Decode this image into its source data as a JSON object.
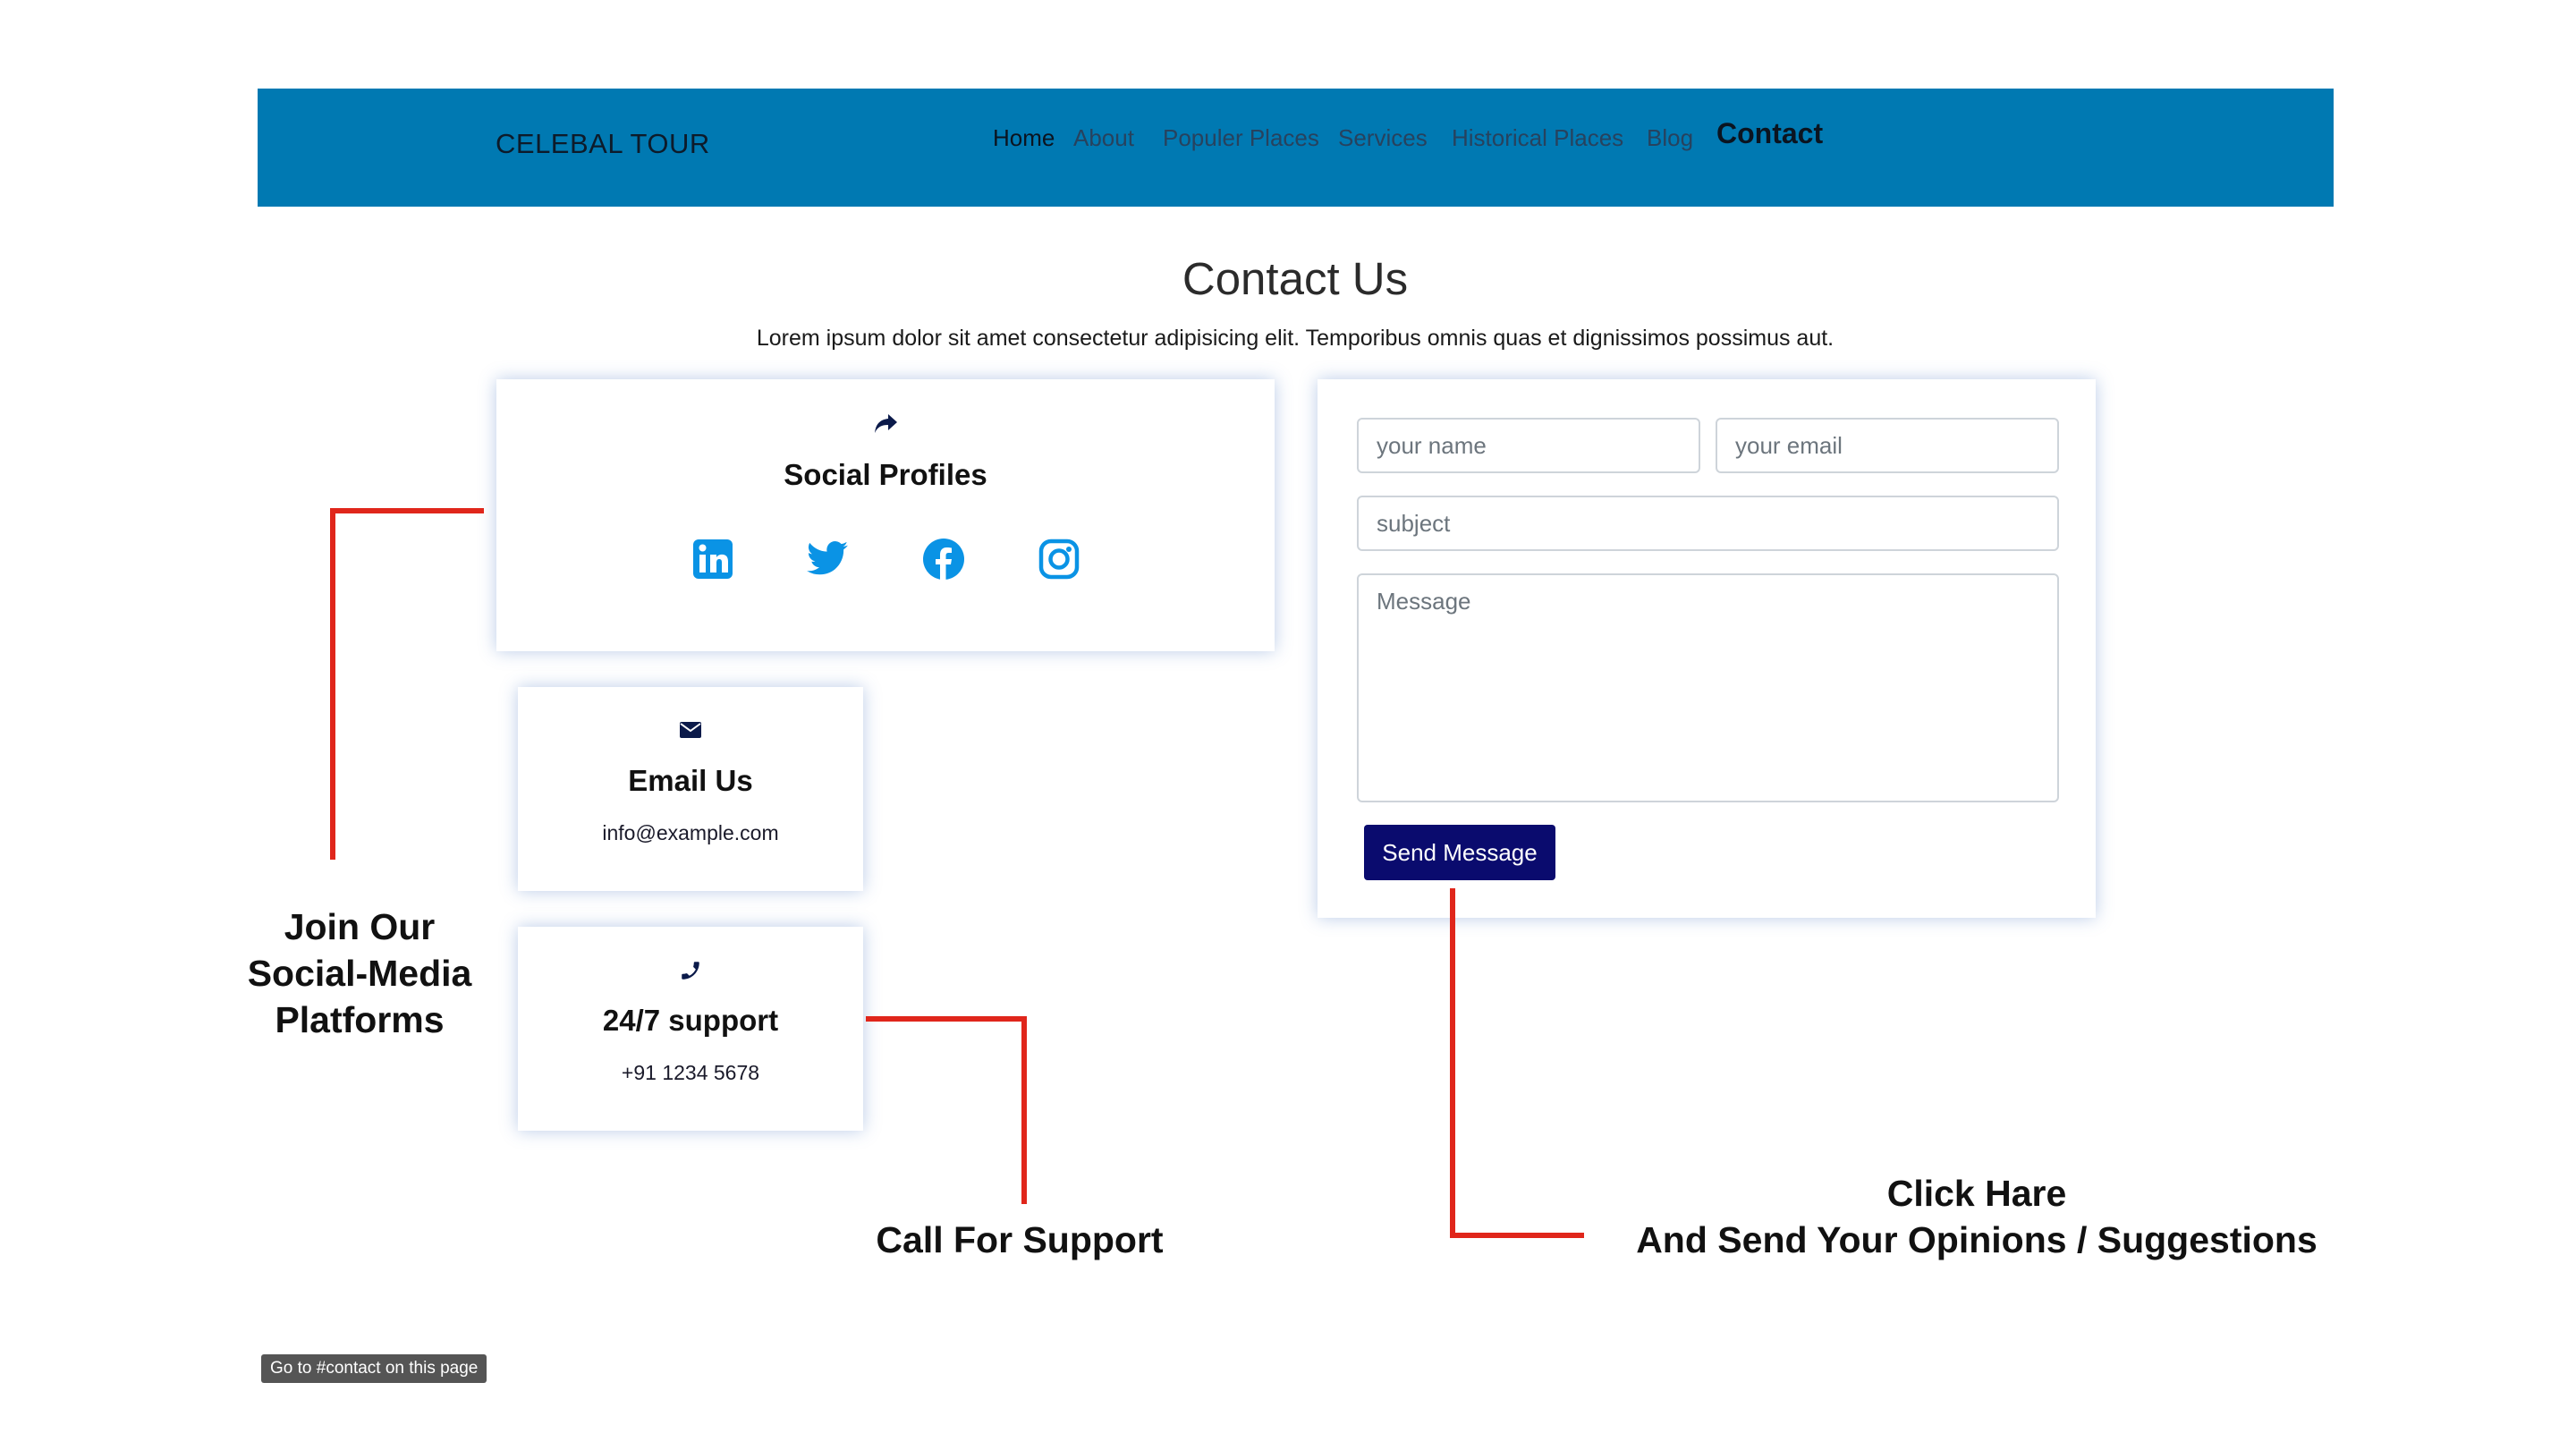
{
  "navbar": {
    "brand": "CELEBAL TOUR",
    "items": [
      {
        "label": "Home"
      },
      {
        "label": "About"
      },
      {
        "label": "Populer Places"
      },
      {
        "label": "Services"
      },
      {
        "label": "Historical Places"
      },
      {
        "label": "Blog"
      },
      {
        "label": "Contact"
      }
    ],
    "background": "#0079b2"
  },
  "page": {
    "title": "Contact Us",
    "subtitle": "Lorem ipsum dolor sit amet consectetur adipisicing elit. Temporibus omnis quas et dignissimos possimus aut."
  },
  "social_card": {
    "icon": "share-icon",
    "title": "Social Profiles",
    "links": [
      {
        "icon": "linkedin-icon"
      },
      {
        "icon": "twitter-icon"
      },
      {
        "icon": "facebook-icon"
      },
      {
        "icon": "instagram-icon"
      }
    ],
    "icon_color": "#0a93e5"
  },
  "email_card": {
    "icon": "envelope-icon",
    "title": "Email Us",
    "text": "info@example.com"
  },
  "phone_card": {
    "icon": "phone-icon",
    "title": "24/7 support",
    "text": "+91 1234 5678"
  },
  "contact_form": {
    "name_placeholder": "your name",
    "email_placeholder": "your email",
    "subject_placeholder": "subject",
    "message_placeholder": "Message",
    "submit_label": "Send Message",
    "submit_color": "#0a0b6e"
  },
  "annotations": {
    "social": [
      "Join Our",
      "Social-Media",
      "Platforms"
    ],
    "support": "Call For Support",
    "form": [
      "Click Hare",
      "And Send Your Opinions / Suggestions"
    ],
    "line_color": "#e0261b"
  },
  "status_pill": "Go to #contact on this page"
}
